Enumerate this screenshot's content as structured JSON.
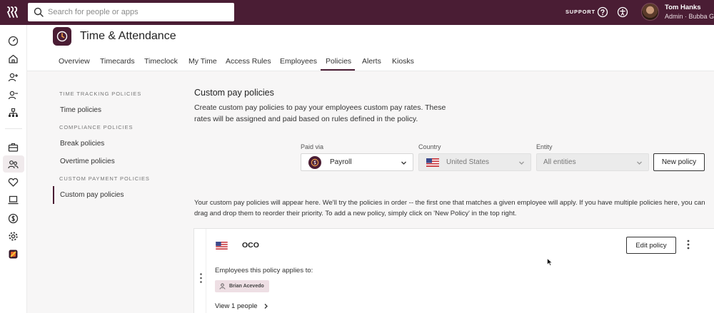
{
  "topbar": {
    "search_placeholder": "Search for people or apps",
    "support_label": "SUPPORT",
    "user_name": "Tom Hanks",
    "user_role": "Admin · Bubba G"
  },
  "app": {
    "title": "Time & Attendance",
    "tabs": [
      {
        "label": "Overview"
      },
      {
        "label": "Timecards"
      },
      {
        "label": "Timeclock"
      },
      {
        "label": "My Time"
      },
      {
        "label": "Access Rules"
      },
      {
        "label": "Employees"
      },
      {
        "label": "Policies",
        "active": true
      },
      {
        "label": "Alerts"
      },
      {
        "label": "Kiosks"
      }
    ]
  },
  "sidenav": {
    "sections": [
      {
        "heading": "TIME TRACKING POLICIES",
        "items": [
          "Time policies"
        ]
      },
      {
        "heading": "COMPLIANCE POLICIES",
        "items": [
          "Break policies",
          "Overtime policies"
        ]
      },
      {
        "heading": "CUSTOM PAYMENT POLICIES",
        "items": [
          "Custom pay policies"
        ]
      }
    ],
    "active_item": "Custom pay policies"
  },
  "main": {
    "title": "Custom pay policies",
    "description": "Create custom pay policies to pay your employees custom pay rates. These rates will be assigned and paid based on rules defined in the policy.",
    "filters": {
      "paid_via": {
        "label": "Paid via",
        "value": "Payroll"
      },
      "country": {
        "label": "Country",
        "value": "United States"
      },
      "entity": {
        "label": "Entity",
        "value": "All entities"
      }
    },
    "new_policy_label": "New policy",
    "info_text": "Your custom pay policies will appear here. We'll try the policies in order -- the first one that matches a given employee will apply. If you have multiple policies here, you can drag and drop them to reorder their priority. To add a new policy, simply click on 'New Policy' in the top right."
  },
  "policy_card": {
    "name": "OCO",
    "edit_label": "Edit policy",
    "applies_label": "Employees this policy applies to:",
    "employee_chip": "Brian Acevedo",
    "view_people_label": "View 1 people"
  },
  "colors": {
    "brand": "#4a1d34",
    "chip_bg": "#eedfe4",
    "content_bg": "#f7f6f6"
  }
}
